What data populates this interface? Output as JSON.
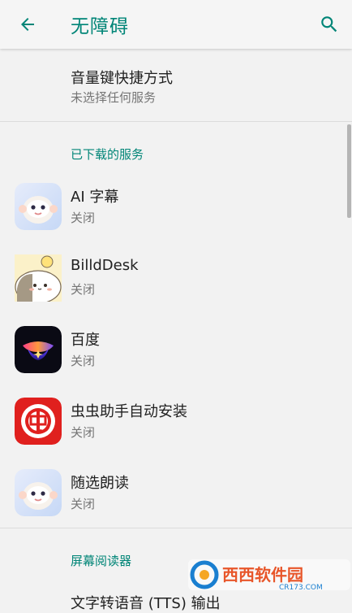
{
  "appbar": {
    "title": "无障碍",
    "back_icon": "arrow-back-icon",
    "search_icon": "search-icon",
    "accent_color": "#008577"
  },
  "shortcut": {
    "title": "音量键快捷方式",
    "summary": "未选择任何服务"
  },
  "downloaded_section": {
    "header": "已下载的服务",
    "items": [
      {
        "name": "AI 字幕",
        "state": "关闭",
        "icon": "robot-face-icon"
      },
      {
        "name": "BilldDesk",
        "state": "关闭",
        "icon": "cartoon-cat-icon"
      },
      {
        "name": "百度",
        "state": "关闭",
        "icon": "baidu-lamp-icon"
      },
      {
        "name": "虫虫助手自动安装",
        "state": "关闭",
        "icon": "chongchong-icon"
      },
      {
        "name": "随选朗读",
        "state": "关闭",
        "icon": "robot-face-icon"
      }
    ]
  },
  "screen_reader_section": {
    "header": "屏幕阅读器",
    "first_item_partial": "文字转语音 (TTS) 输出"
  },
  "watermark": {
    "text": "西西软件园",
    "sub": "CR173.COM"
  }
}
